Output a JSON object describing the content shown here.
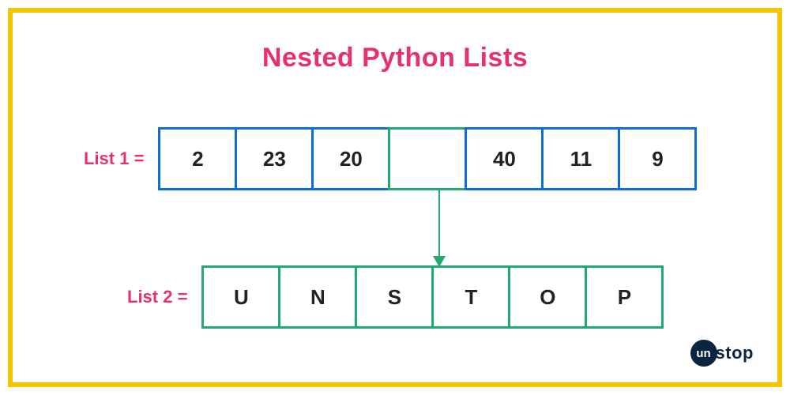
{
  "title": "Nested Python Lists",
  "list1": {
    "label": "List 1 =",
    "cells": [
      "2",
      "23",
      "20",
      "",
      "40",
      "11",
      "9"
    ],
    "nested_index": 3
  },
  "list2": {
    "label": "List 2 =",
    "cells": [
      "U",
      "N",
      "S",
      "T",
      "O",
      "P"
    ]
  },
  "logo": {
    "circle": "un",
    "text": "stop"
  },
  "colors": {
    "border": "#f5c400",
    "accent": "#e6316e",
    "blue": "#0b6fd6",
    "green": "#20a971",
    "dark": "#0a2540"
  }
}
